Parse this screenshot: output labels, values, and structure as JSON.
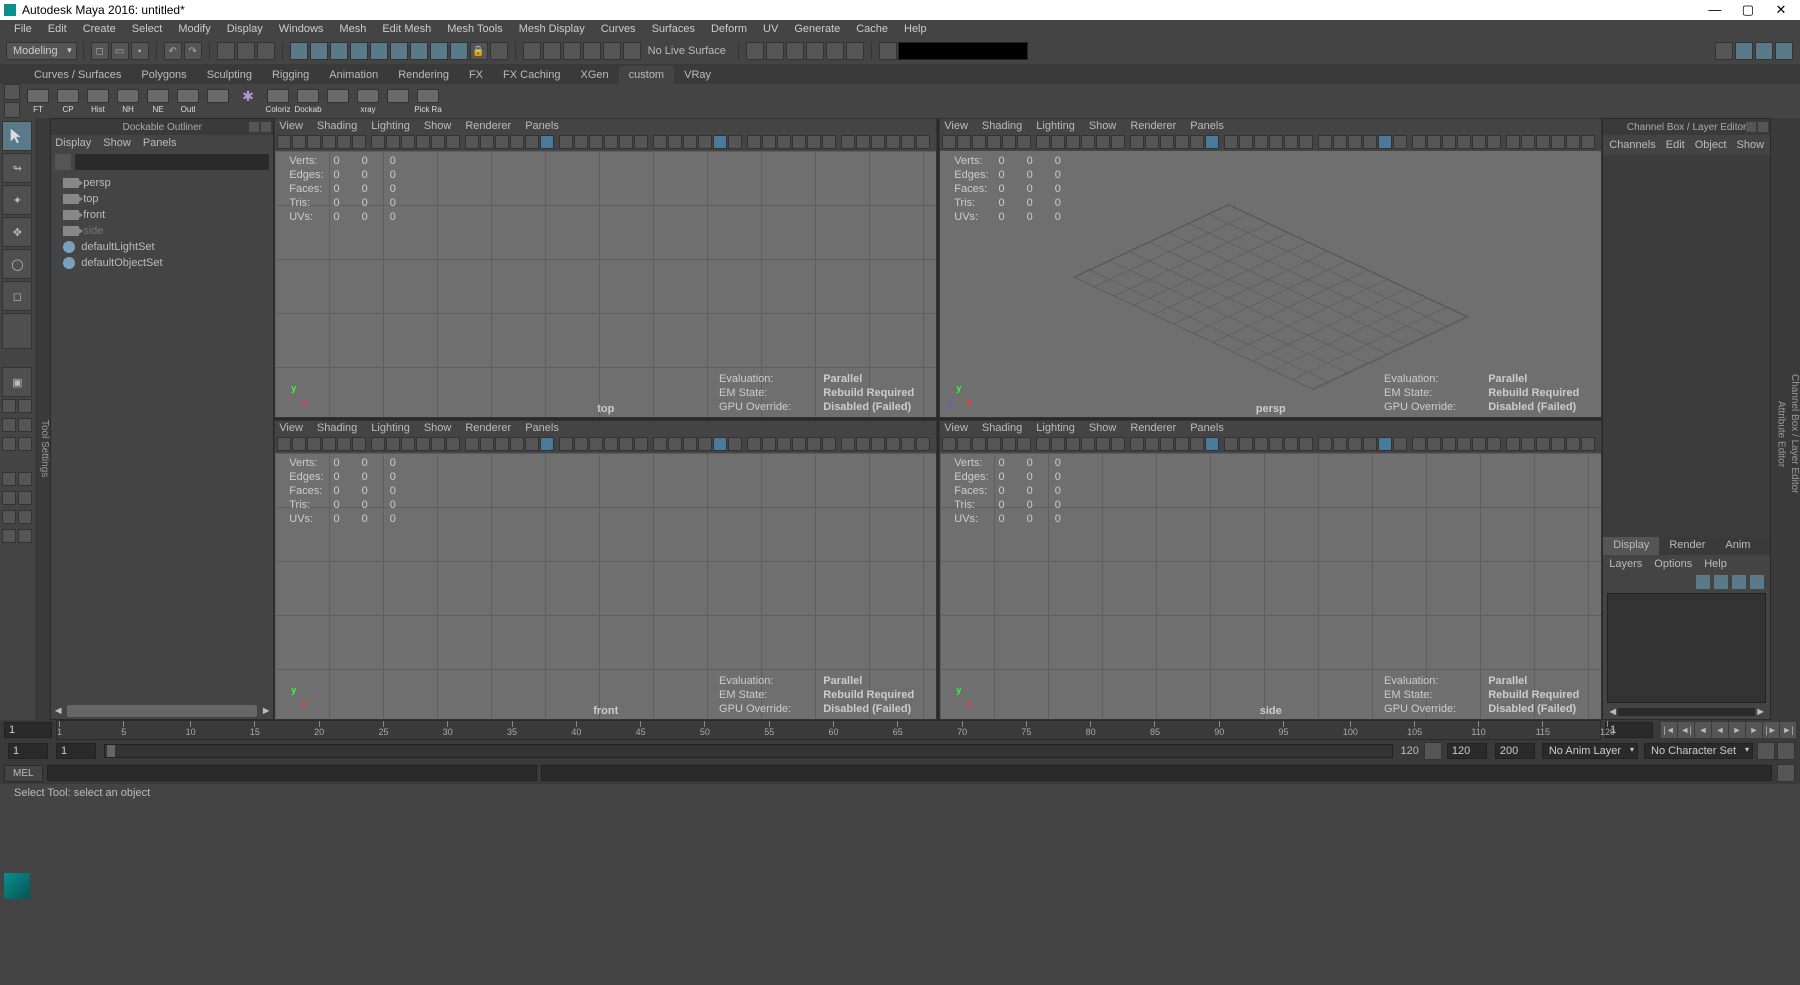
{
  "title": "Autodesk Maya 2016: untitled*",
  "menu_bar": [
    "File",
    "Edit",
    "Create",
    "Select",
    "Modify",
    "Display",
    "Windows",
    "Mesh",
    "Edit Mesh",
    "Mesh Tools",
    "Mesh Display",
    "Curves",
    "Surfaces",
    "Deform",
    "UV",
    "Generate",
    "Cache",
    "Help"
  ],
  "mode": "Modeling",
  "no_live_surface": "No Live Surface",
  "shelf_tabs": [
    "Curves / Surfaces",
    "Polygons",
    "Sculpting",
    "Rigging",
    "Animation",
    "Rendering",
    "FX",
    "FX Caching",
    "XGen",
    "custom",
    "VRay"
  ],
  "shelf_active": "custom",
  "shelf_items": [
    "FT",
    "CP",
    "Hist",
    "NH",
    "NE",
    "Outl",
    "",
    "",
    "Coloriz",
    "Dockab",
    "",
    "xray",
    "",
    "Pick Ra"
  ],
  "outliner": {
    "title": "Dockable Outliner",
    "menus": [
      "Display",
      "Show",
      "Panels"
    ],
    "items": [
      {
        "type": "cam",
        "label": "persp",
        "dim": false
      },
      {
        "type": "cam",
        "label": "top",
        "dim": false
      },
      {
        "type": "cam",
        "label": "front",
        "dim": false
      },
      {
        "type": "cam",
        "label": "side",
        "dim": true
      },
      {
        "type": "set",
        "label": "defaultLightSet",
        "dim": false
      },
      {
        "type": "set",
        "label": "defaultObjectSet",
        "dim": false
      }
    ]
  },
  "tool_settings_label": "Tool Settings",
  "viewport_menus": [
    "View",
    "Shading",
    "Lighting",
    "Show",
    "Renderer",
    "Panels"
  ],
  "hud_stats": {
    "rows": [
      "Verts:",
      "Edges:",
      "Faces:",
      "Tris:",
      "UVs:"
    ],
    "cols": [
      "0",
      "0",
      "0"
    ]
  },
  "hud_eval": {
    "Evaluation:": "Parallel",
    "EM State:": "Rebuild Required",
    "GPU Override:": "Disabled (Failed)"
  },
  "cameras": {
    "tl": "top",
    "tr": "persp",
    "bl": "front",
    "br": "side"
  },
  "channel_box": {
    "title": "Channel Box / Layer Editor",
    "menus": [
      "Channels",
      "Edit",
      "Object",
      "Show"
    ],
    "tabs": [
      "Display",
      "Render",
      "Anim"
    ],
    "layer_menus": [
      "Layers",
      "Options",
      "Help"
    ]
  },
  "side_strips": [
    "Attribute Editor",
    "Channel Box / Layer Editor"
  ],
  "time_ticks": [
    "1",
    "5",
    "10",
    "15",
    "20",
    "25",
    "30",
    "35",
    "40",
    "45",
    "50",
    "55",
    "60",
    "65",
    "70",
    "75",
    "80",
    "85",
    "90",
    "95",
    "100",
    "105",
    "110",
    "115",
    "120"
  ],
  "start_field": "1",
  "end_field": "1",
  "range": {
    "start": "1",
    "end": "1",
    "min": "1",
    "max": "120",
    "total": "200"
  },
  "no_anim_layer": "No Anim Layer",
  "no_char_set": "No Character Set",
  "cmd_label": "MEL",
  "help_line": "Select Tool: select an object",
  "frame_display": "120"
}
